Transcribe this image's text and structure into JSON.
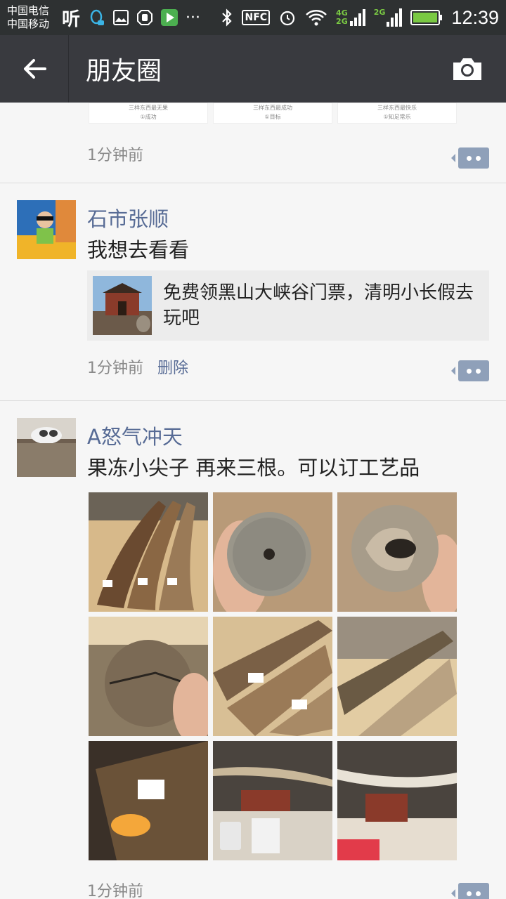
{
  "status_bar": {
    "carrier_1": "中国电信",
    "carrier_2": "中国移动",
    "ting": "听",
    "nfc": "NFC",
    "net_1": "4G",
    "net_2": "2G",
    "net_3": "2G",
    "time": "12:39"
  },
  "header": {
    "title": "朋友圈",
    "back_icon": "arrow-left-icon",
    "camera_icon": "camera-icon"
  },
  "posts": [
    {
      "time": "1分钟前",
      "card_caption_1": "三样东西最无果",
      "card_caption_2": "三样东西最成功",
      "card_caption_3": "三样东西最快乐",
      "card_sub_1": "①成功",
      "card_sub_2": "①目标",
      "card_sub_3": "①知足常乐"
    },
    {
      "author": "石市张顺",
      "text": "我想去看看",
      "share_title": "免费领黑山大峡谷门票，清明小长假去玩吧",
      "time": "1分钟前",
      "delete_label": "删除"
    },
    {
      "author": "A怒气冲天",
      "text": "果冻小尖子 再来三根。可以订工艺品",
      "time": "1分钟前",
      "photos": [
        "tusk-photo-1",
        "tusk-slice-photo-2",
        "tusk-slice-photo-3",
        "tusk-slice-photo-4",
        "tusk-photo-5",
        "tusk-photo-6",
        "tusk-photo-7",
        "tusk-photo-8",
        "tusk-photo-9"
      ]
    }
  ],
  "colors": {
    "link_blue": "#576b95",
    "appbar": "#393a3f",
    "statusbar": "#2e3132",
    "background": "#f6f6f6"
  }
}
